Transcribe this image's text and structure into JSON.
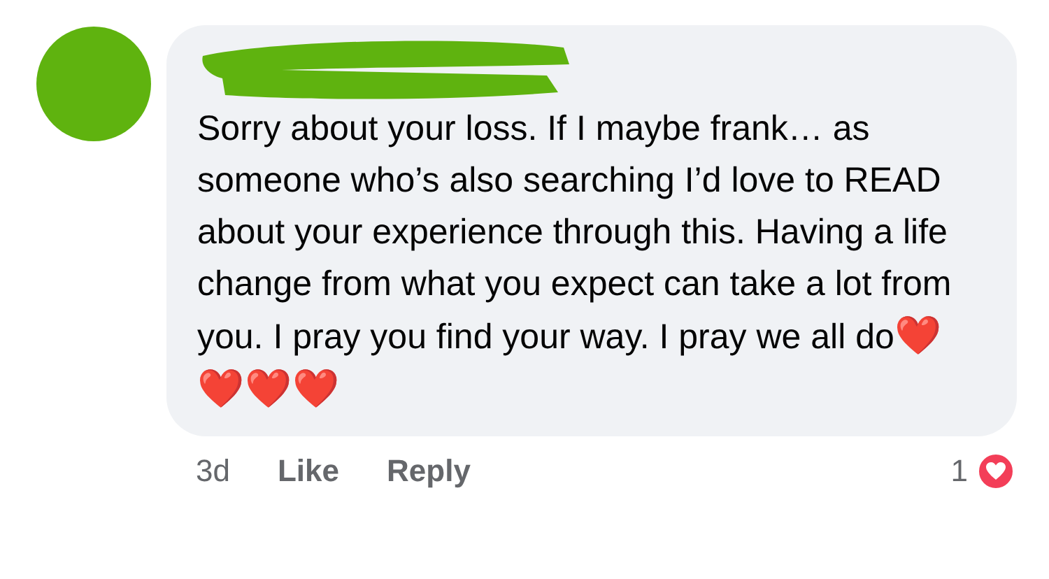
{
  "comment": {
    "text": "Sorry about your loss. If I maybe frank… as someone who’s also searching I’d love to READ about your experience through this. Having a life change from what you expect can take a lot from you. I pray you find your way. I pray we all do",
    "emoji": [
      "❤️",
      "❤️",
      "❤️",
      "❤️"
    ]
  },
  "footer": {
    "time": "3d",
    "actions": [
      "Like",
      "Reply"
    ],
    "reaction_count": "1"
  }
}
